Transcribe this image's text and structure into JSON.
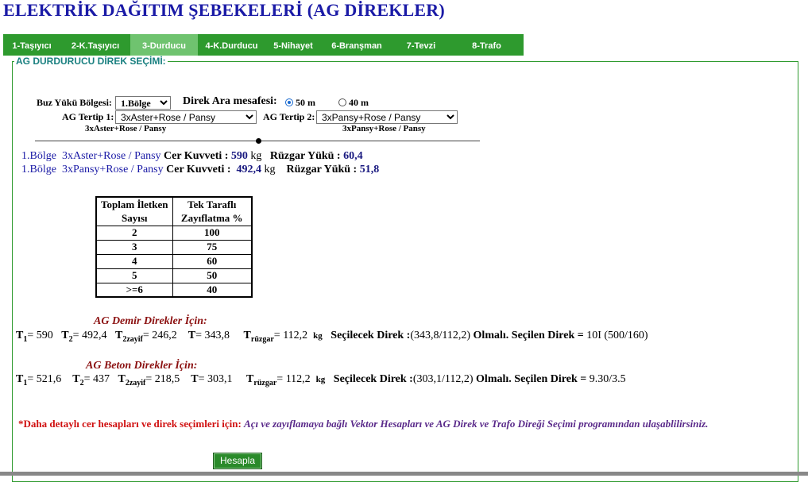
{
  "page_title": "ELEKTRİK DAĞITIM ŞEBEKELERİ (AG DİREKLER)",
  "tabs": [
    {
      "label": "1-Taşıyıcı",
      "active": false
    },
    {
      "label": "2-K.Taşıyıcı",
      "active": false
    },
    {
      "label": "3-Durducu",
      "active": true
    },
    {
      "label": "4-K.Durducu",
      "active": false
    },
    {
      "label": "5-Nihayet",
      "active": false
    },
    {
      "label": "6-Branşman",
      "active": false
    },
    {
      "label": "7-Tevzi",
      "active": false
    },
    {
      "label": "8-Trafo",
      "active": false
    }
  ],
  "section_legend": "AG DURDURUCU DİREK SEÇİMİ:",
  "form": {
    "ice_zone_label": "Buz Yükü Bölgesi:",
    "ice_zone_value": "1.Bölge",
    "span_label": "Direk Ara mesafesi:",
    "span_option_1": "50 m",
    "span_option_2": "40 m",
    "span_selected": "50 m",
    "arr1_label": "AG Tertip 1:",
    "arr1_value": "3xAster+Rose / Pansy",
    "arr1_caption": "3xAster+Rose / Pansy",
    "arr2_label": "AG Tertip 2:",
    "arr2_value": "3xPansy+Rose / Pansy",
    "arr2_caption": "3xPansy+Rose / Pansy"
  },
  "results": [
    {
      "zone": "1.Bölge",
      "conductor": "3xAster+Rose / Pansy",
      "tension_label": "Cer Kuvveti :",
      "tension": "590",
      "unit": "kg",
      "wind_label": "Rüzgar Yükü :",
      "wind": "60,4"
    },
    {
      "zone": "1.Bölge",
      "conductor": "3xPansy+Rose / Pansy",
      "tension_label": "Cer Kuvveti :",
      "tension": "492,4",
      "unit": "kg",
      "wind_label": "Rüzgar Yükü :",
      "wind": "51,8"
    }
  ],
  "table": {
    "header_col1_line1": "Toplam İletken",
    "header_col1_line2": "Sayısı",
    "header_col2_line1": "Tek Taraflı",
    "header_col2_line2": "Zayıflatma %",
    "rows": [
      {
        "count": "2",
        "pct": "100"
      },
      {
        "count": "3",
        "pct": "75"
      },
      {
        "count": "4",
        "pct": "60"
      },
      {
        "count": "5",
        "pct": "50"
      },
      {
        "count": ">=6",
        "pct": "40"
      }
    ]
  },
  "demir": {
    "heading": "AG Demir Direkler İçin:",
    "t1": "590",
    "t2": "492,4",
    "t2zayif": "246,2",
    "t": "343,8",
    "truzgar": "112,2",
    "unit": "kg",
    "secilecek_label": "Seçilecek Direk :",
    "secilecek": "(343,8/112,2)",
    "olmali": "Olmalı.",
    "secilen_label": "Seçilen Direk = ",
    "secilen": "10I (500/160)"
  },
  "beton": {
    "heading": "AG Beton Direkler İçin:",
    "t1": "521,6",
    "t2": "437",
    "t2zayif": "218,5",
    "t": "303,1",
    "truzgar": "112,2",
    "unit": "kg",
    "secilecek_label": "Seçilecek Direk :",
    "secilecek": "(303,1/112,2)",
    "olmali": "Olmalı.",
    "secilen_label": "Seçilen Direk = ",
    "secilen": "9.30/3.5"
  },
  "labels": {
    "t1": "T",
    "t1_sub": "1",
    "t2": "T",
    "t2_sub": "2",
    "t2z": "T",
    "t2z_sub": "2zayif",
    "t": "T",
    "tr": "T",
    "tr_sub": "rüzgar",
    "eq": "= "
  },
  "note": {
    "red_part": "*Daha detaylı cer  hesapları ve direk seçimleri için:",
    "purple_part": "Açı ve zayıflamaya bağlı Vektor Hesapları ve AG Direk ve Trafo Direği Seçimi programından ulaşablilirsiniz."
  },
  "calc_button": "Hesapla",
  "colors": {
    "tab_bar": "#2e9a2e",
    "tab_active": "#6fc36f",
    "title": "#1a1aa6",
    "heading": "#8b1010"
  }
}
